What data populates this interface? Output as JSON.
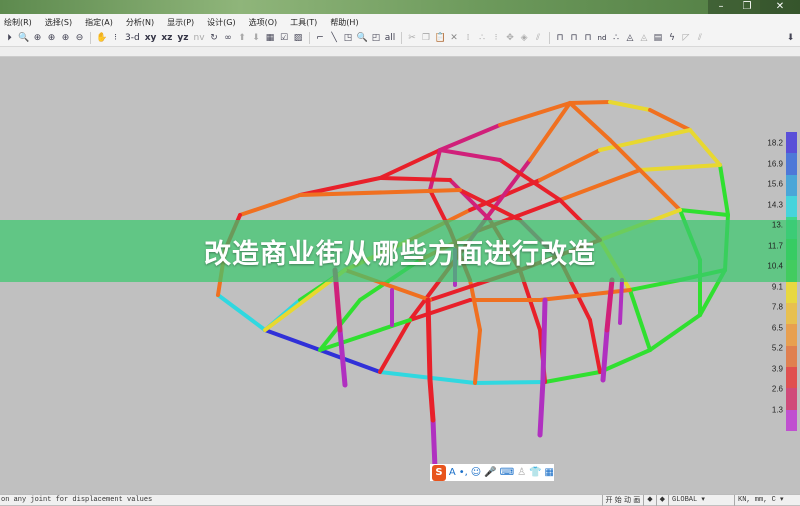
{
  "window": {
    "minimize": "–",
    "restore": "❐",
    "close": "✕"
  },
  "menu": [
    "绘制(R)",
    "选择(S)",
    "指定(A)",
    "分析(N)",
    "显示(P)",
    "设计(G)",
    "选项(O)",
    "工具(T)",
    "帮助(H)"
  ],
  "toolbar": {
    "view_3d": "3-d",
    "view_xy": "xy",
    "view_xz": "xz",
    "view_yz": "yz",
    "view_nv": "nv",
    "nd": "nd"
  },
  "legend": {
    "values": [
      "18.2",
      "16.9",
      "15.6",
      "14.3",
      "13.",
      "11.7",
      "10.4",
      "9.1",
      "7.8",
      "6.5",
      "5.2",
      "3.9",
      "2.6",
      "1.3"
    ],
    "colors": [
      "#5a4fd8",
      "#4e78d8",
      "#4aa6d8",
      "#46d4dc",
      "#3ed88c",
      "#2ed84a",
      "#52d83a",
      "#e8d840",
      "#e8c050",
      "#e8a050",
      "#e08050",
      "#e05050",
      "#d04a7a",
      "#c050d0"
    ]
  },
  "banner": {
    "title": "改造商业街从哪些方面进行改造"
  },
  "ime": {
    "letter": "A",
    "logo": "S"
  },
  "status": {
    "message": "on any joint for displacement values",
    "animate": "开 始 动 画",
    "coord_system": "GLOBAL",
    "units": "KN, mm, C"
  }
}
